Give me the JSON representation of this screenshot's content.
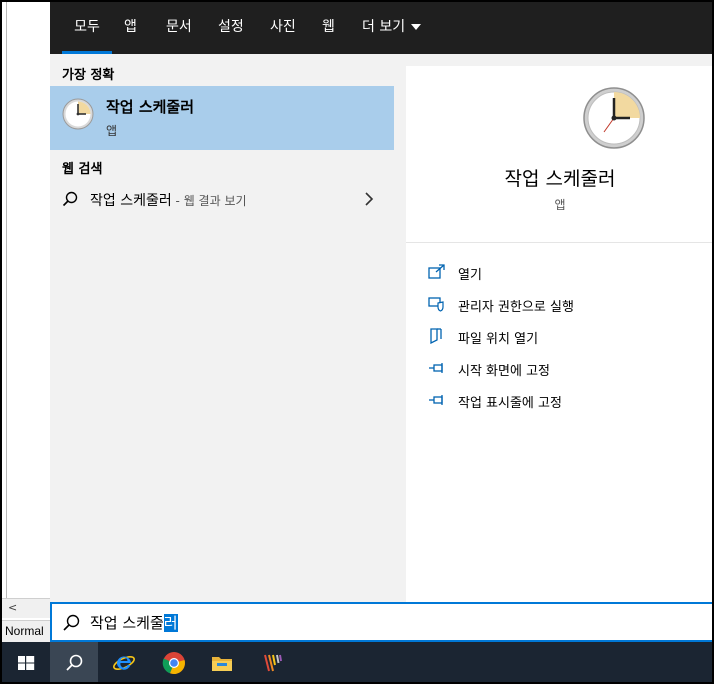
{
  "tabs": [
    {
      "label": "모두",
      "active": true
    },
    {
      "label": "앱"
    },
    {
      "label": "문서"
    },
    {
      "label": "설정"
    },
    {
      "label": "사진"
    },
    {
      "label": "웹"
    },
    {
      "label": "더 보기"
    }
  ],
  "left": {
    "best_match_heading": "가장 정확",
    "best_match": {
      "title": "작업 스케줄러",
      "subtitle": "앱"
    },
    "web_heading": "웹 검색",
    "web_item": {
      "query": "작업 스케줄러",
      "suffix": " - 웹 결과 보기"
    }
  },
  "preview": {
    "name": "작업 스케줄러",
    "kind": "앱",
    "actions": [
      {
        "label": "열기",
        "icon": "open-icon"
      },
      {
        "label": "관리자 권한으로 실행",
        "icon": "shield-icon"
      },
      {
        "label": "파일 위치 열기",
        "icon": "file-location-icon"
      },
      {
        "label": "시작 화면에 고정",
        "icon": "pin-icon"
      },
      {
        "label": "작업 표시줄에 고정",
        "icon": "pin-icon"
      }
    ]
  },
  "search": {
    "typed": "작업 스케줄",
    "selected": "러"
  },
  "background_app": {
    "status": "Normal"
  },
  "taskbar": {
    "items": [
      "windows-start-icon",
      "search-icon",
      "internet-explorer-icon",
      "chrome-icon",
      "file-explorer-icon",
      "app-icon"
    ]
  },
  "colors": {
    "accent": "#0078d7",
    "tabbar": "#1f1f1f",
    "selection": "#a9cdeb",
    "taskbar": "#1b2532"
  }
}
